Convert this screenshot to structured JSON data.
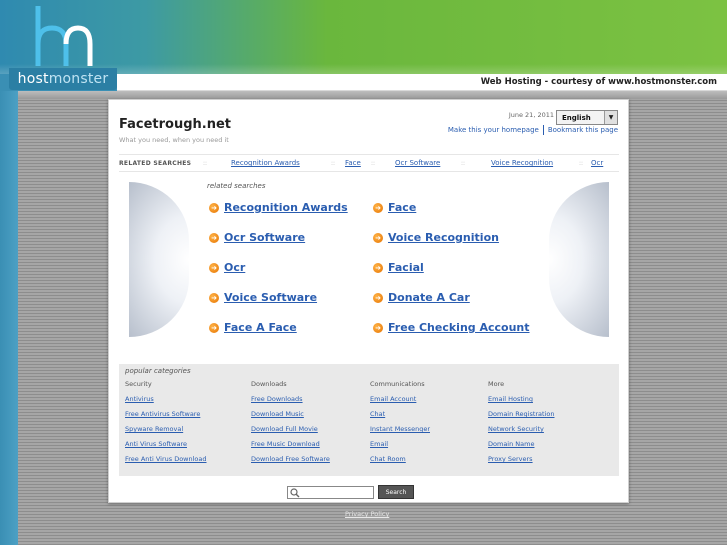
{
  "brand": {
    "name_part1": "host",
    "name_part2": "monster",
    "banner_text": "Web Hosting - courtesy of www.hostmonster.com",
    "accent_blue": "#2b7fa4",
    "accent_green": "#7cc242"
  },
  "site": {
    "title": "Facetrough.net",
    "tagline": "What you need, when you need it",
    "date": "June 21, 2011",
    "language": "English",
    "make_homepage": "Make this your homepage",
    "bookmark": "Bookmark this page"
  },
  "related_bar": {
    "label": "RELATED SEARCHES",
    "links": [
      "Recognition Awards",
      "Face",
      "Ocr Software",
      "Voice Recognition",
      "Ocr"
    ]
  },
  "related": {
    "title": "related searches",
    "items": [
      "Recognition Awards",
      "Face",
      "Ocr Software",
      "Voice Recognition",
      "Ocr",
      "Facial",
      "Voice Software",
      "Donate A Car",
      "Face A Face",
      "Free Checking Account"
    ]
  },
  "popular": {
    "title": "popular categories",
    "columns": [
      {
        "heading": "Security",
        "links": [
          "Antivirus",
          "Free Antivirus Software",
          "Spyware Removal",
          "Anti Virus Software",
          "Free Anti Virus Download"
        ]
      },
      {
        "heading": "Downloads",
        "links": [
          "Free Downloads",
          "Download Music",
          "Download Full Movie",
          "Free Music Download",
          "Download Free Software"
        ]
      },
      {
        "heading": "Communications",
        "links": [
          "Email Account",
          "Chat",
          "Instant Messenger",
          "Email",
          "Chat Room"
        ]
      },
      {
        "heading": "More",
        "links": [
          "Email Hosting",
          "Domain Registration",
          "Network Security",
          "Domain Name",
          "Proxy Servers"
        ]
      }
    ]
  },
  "search": {
    "button_label": "Search",
    "value": ""
  },
  "footer": {
    "privacy": "Privacy Policy"
  }
}
